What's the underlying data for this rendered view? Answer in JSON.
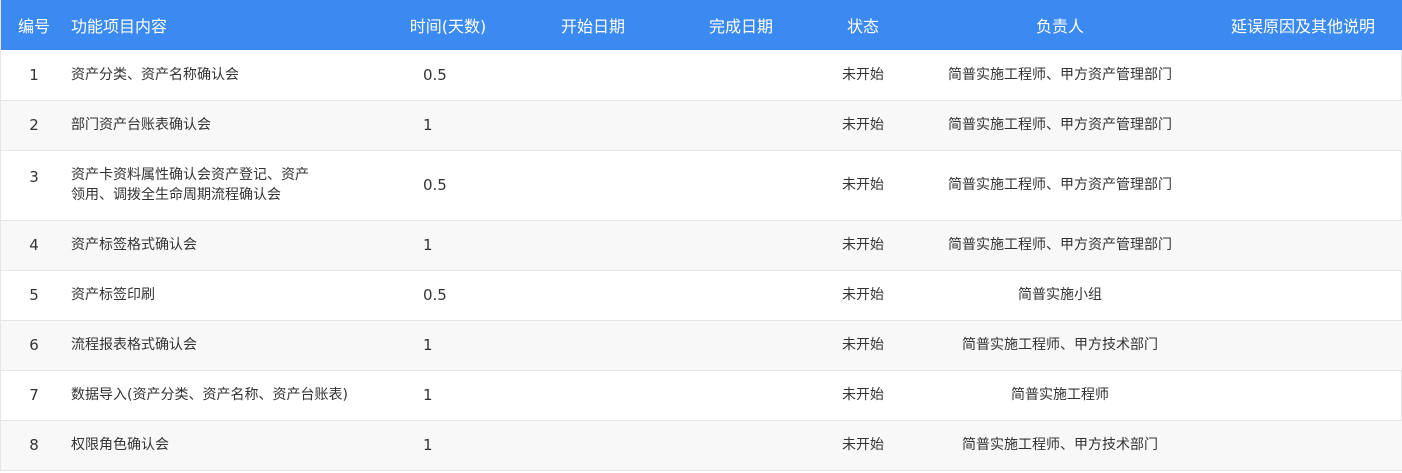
{
  "table": {
    "headers": {
      "id": "编号",
      "content": "功能项目内容",
      "time": "时间(天数)",
      "start": "开始日期",
      "finish": "完成日期",
      "status": "状态",
      "owner": "负责人",
      "delay": "延误原因及其他说明"
    },
    "rows": [
      {
        "id": "1",
        "content": "资产分类、资产名称确认会",
        "time": "0.5",
        "start": "",
        "finish": "",
        "status": "未开始",
        "owner": "简普实施工程师、甲方资产管理部门",
        "delay": ""
      },
      {
        "id": "2",
        "content": "部门资产台账表确认会",
        "time": "1",
        "start": "",
        "finish": "",
        "status": "未开始",
        "owner": "简普实施工程师、甲方资产管理部门",
        "delay": ""
      },
      {
        "id": "3",
        "content": "资产卡资料属性确认会资产登记、资产\n领用、调拨全生命周期流程确认会",
        "time": "0.5",
        "start": "",
        "finish": "",
        "status": "未开始",
        "owner": "简普实施工程师、甲方资产管理部门",
        "delay": ""
      },
      {
        "id": "4",
        "content": "资产标签格式确认会",
        "time": "1",
        "start": "",
        "finish": "",
        "status": "未开始",
        "owner": "简普实施工程师、甲方资产管理部门",
        "delay": ""
      },
      {
        "id": "5",
        "content": "资产标签印刷",
        "time": "0.5",
        "start": "",
        "finish": "",
        "status": "未开始",
        "owner": "简普实施小组",
        "delay": ""
      },
      {
        "id": "6",
        "content": "流程报表格式确认会",
        "time": "1",
        "start": "",
        "finish": "",
        "status": "未开始",
        "owner": "简普实施工程师、甲方技术部门",
        "delay": ""
      },
      {
        "id": "7",
        "content": "数据导入(资产分类、资产名称、资产台账表)",
        "time": "1",
        "start": "",
        "finish": "",
        "status": "未开始",
        "owner": "简普实施工程师",
        "delay": ""
      },
      {
        "id": "8",
        "content": "权限角色确认会",
        "time": "1",
        "start": "",
        "finish": "",
        "status": "未开始",
        "owner": "简普实施工程师、甲方技术部门",
        "delay": ""
      }
    ]
  },
  "colors": {
    "header_bg": "#3b8af2",
    "header_text": "#ffffff",
    "row_alt_bg": "#f8f8f8",
    "border": "#e6e6e6"
  }
}
